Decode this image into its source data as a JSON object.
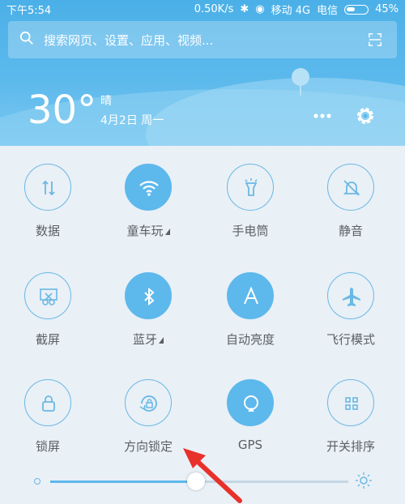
{
  "status": {
    "time": "下午5:54",
    "speed": "0.50K/s",
    "carrier1": "移动 4G",
    "carrier2": "电信",
    "battery": "45%"
  },
  "search": {
    "placeholder": "搜索网页、设置、应用、视频..."
  },
  "weather": {
    "temp": "30°",
    "condition": "晴",
    "date": "4月2日 周一"
  },
  "toggles": [
    {
      "label": "数据",
      "icon": "data-arrows-icon",
      "on": false
    },
    {
      "label": "童车玩",
      "icon": "wifi-icon",
      "on": true
    },
    {
      "label": "手电筒",
      "icon": "flashlight-icon",
      "on": false
    },
    {
      "label": "静音",
      "icon": "bell-mute-icon",
      "on": false
    },
    {
      "label": "截屏",
      "icon": "scissors-icon",
      "on": false
    },
    {
      "label": "蓝牙",
      "icon": "bluetooth-icon",
      "on": true
    },
    {
      "label": "自动亮度",
      "icon": "auto-brightness-icon",
      "on": true
    },
    {
      "label": "飞行模式",
      "icon": "airplane-icon",
      "on": false
    },
    {
      "label": "锁屏",
      "icon": "lock-icon",
      "on": false
    },
    {
      "label": "方向锁定",
      "icon": "rotation-lock-icon",
      "on": false
    },
    {
      "label": "GPS",
      "icon": "gps-icon",
      "on": true
    },
    {
      "label": "开关排序",
      "icon": "grid-icon",
      "on": false
    }
  ],
  "brightness": {
    "level": 0.49
  },
  "colors": {
    "accent": "#5db8ec",
    "header": "#4bb0e8",
    "annotation": "#e8312a"
  }
}
